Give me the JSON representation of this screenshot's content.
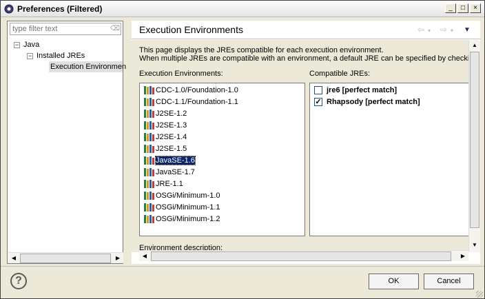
{
  "window": {
    "title": "Preferences (Filtered)",
    "controls": {
      "minimize": "_",
      "maximize": "□",
      "close": "×"
    }
  },
  "sidebar": {
    "filter_placeholder": "type filter text",
    "tree": [
      {
        "label": "Java",
        "toggle": "−"
      },
      {
        "label": "Installed JREs",
        "toggle": "−"
      },
      {
        "label": "Execution Environmen"
      }
    ]
  },
  "main": {
    "page_title": "Execution Environments",
    "description_lines": [
      "This page displays the JREs compatible for each execution environment.",
      "When multiple JREs are compatible with an environment, a default JRE can be specified by checking"
    ],
    "environments_label": "Execution Environments:",
    "compatible_label": "Compatible JREs:",
    "environment_description_label": "Environment description:",
    "environments": [
      "CDC-1.0/Foundation-1.0",
      "CDC-1.1/Foundation-1.1",
      "J2SE-1.2",
      "J2SE-1.3",
      "J2SE-1.4",
      "J2SE-1.5",
      "JavaSE-1.6",
      "JavaSE-1.7",
      "JRE-1.1",
      "OSGi/Minimum-1.0",
      "OSGi/Minimum-1.1",
      "OSGi/Minimum-1.2"
    ],
    "selected_environment": "JavaSE-1.6",
    "compatible_jres": [
      {
        "label": "jre6 [perfect match]",
        "checked": false
      },
      {
        "label": "Rhapsody [perfect match]",
        "checked": true
      }
    ]
  },
  "footer": {
    "help_label": "?",
    "ok_label": "OK",
    "cancel_label": "Cancel"
  },
  "colors": {
    "selection": "#0a246a",
    "background": "#ece9d8"
  }
}
